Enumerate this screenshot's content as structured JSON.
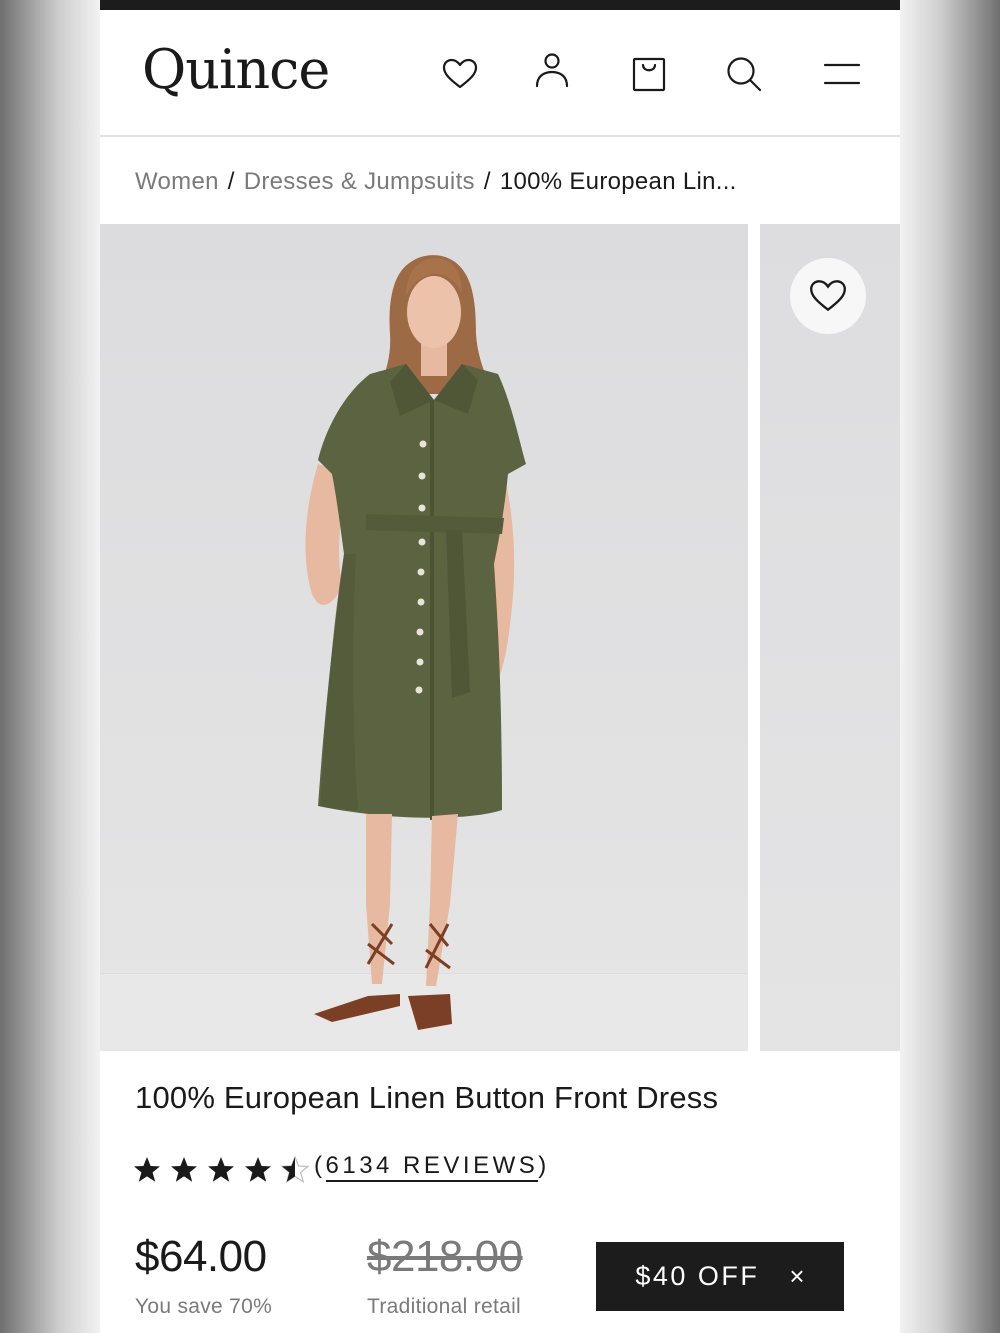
{
  "header": {
    "logo": "Quince",
    "icons": [
      "heart-icon",
      "account-icon",
      "bag-icon",
      "search-icon",
      "menu-icon"
    ]
  },
  "breadcrumb": {
    "items": [
      "Women",
      "Dresses & Jumpsuits",
      "100% European Lin..."
    ],
    "separator": "/"
  },
  "gallery": {
    "favorite_icon": "heart-icon"
  },
  "product": {
    "title": "100% European Linen Button Front Dress",
    "rating": 4.5,
    "rating_max": 5,
    "reviews_open": "(",
    "reviews_label": "6134 REVIEWS",
    "reviews_close": ")",
    "price": "$64.00",
    "savings": "You save 70%",
    "retail_price": "$218.00",
    "retail_label": "Traditional retail"
  },
  "offer": {
    "label": "$40 OFF",
    "close": "×"
  },
  "colors": {
    "text": "#1a1a1a",
    "muted": "#7a7a7a",
    "dress": "#5b6340",
    "offer_bg": "#1c1c1c"
  }
}
